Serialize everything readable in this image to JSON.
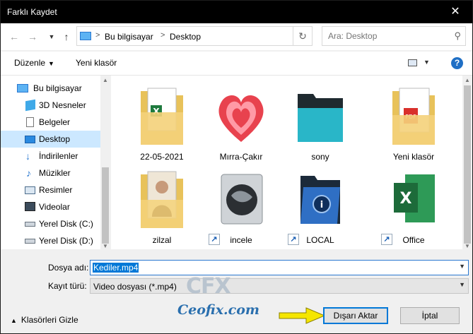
{
  "window": {
    "title": "Farklı Kaydet",
    "close_glyph": "✕"
  },
  "nav": {
    "back_icon": "arrow-left-icon",
    "forward_icon": "arrow-right-icon",
    "recent_icon": "chevron-down-icon",
    "up_icon": "arrow-up-icon"
  },
  "address": {
    "crumbs": [
      "Bu bilgisayar",
      "Desktop"
    ],
    "separator": ">"
  },
  "search": {
    "placeholder": "Ara: Desktop"
  },
  "toolbar": {
    "organize_label": "Düzenle",
    "new_folder_label": "Yeni klasör",
    "help_label": "?"
  },
  "sidebar": {
    "items": [
      {
        "label": "Bu bilgisayar",
        "icon": "computer-icon",
        "selected": false
      },
      {
        "label": "3D Nesneler",
        "icon": "cube-3d-icon",
        "selected": false
      },
      {
        "label": "Belgeler",
        "icon": "document-icon",
        "selected": false
      },
      {
        "label": "Desktop",
        "icon": "desktop-icon",
        "selected": true
      },
      {
        "label": "İndirilenler",
        "icon": "download-icon",
        "selected": false
      },
      {
        "label": "Müzikler",
        "icon": "music-icon",
        "selected": false
      },
      {
        "label": "Resimler",
        "icon": "pictures-icon",
        "selected": false
      },
      {
        "label": "Videolar",
        "icon": "video-icon",
        "selected": false
      },
      {
        "label": "Yerel Disk (C:)",
        "icon": "drive-icon",
        "selected": false
      },
      {
        "label": "Yerel Disk (D:)",
        "icon": "drive-icon",
        "selected": false
      }
    ]
  },
  "files": {
    "items": [
      {
        "label": "22-05-2021",
        "icon": "excel-folder-icon"
      },
      {
        "label": "Mırra-Çakır",
        "icon": "heart-icon"
      },
      {
        "label": "sony",
        "icon": "teal-folder-icon"
      },
      {
        "label": "Yeni klasör",
        "icon": "pdf-folder-icon"
      },
      {
        "label": "zilzal",
        "icon": "photo-folder-icon"
      },
      {
        "label": "incele",
        "icon": "globe-shortcut-icon"
      },
      {
        "label": "LOCAL",
        "icon": "blue-folder-shortcut-icon"
      },
      {
        "label": "Office",
        "icon": "excel-shortcut-icon"
      }
    ]
  },
  "form": {
    "filename_label": "Dosya adı:",
    "filename_value": "Kediler.mp4",
    "filetype_label": "Kayıt türü:",
    "filetype_value": "Video dosyası (*.mp4)",
    "hide_folders_label": "Klasörleri Gizle",
    "save_label": "Dışarı Aktar",
    "cancel_label": "İptal"
  },
  "watermark": {
    "logo": "CFX",
    "site": "Ceofix.com"
  },
  "colors": {
    "selection": "#cce8ff",
    "accent": "#0078d7",
    "arrow": "#f5e600"
  }
}
